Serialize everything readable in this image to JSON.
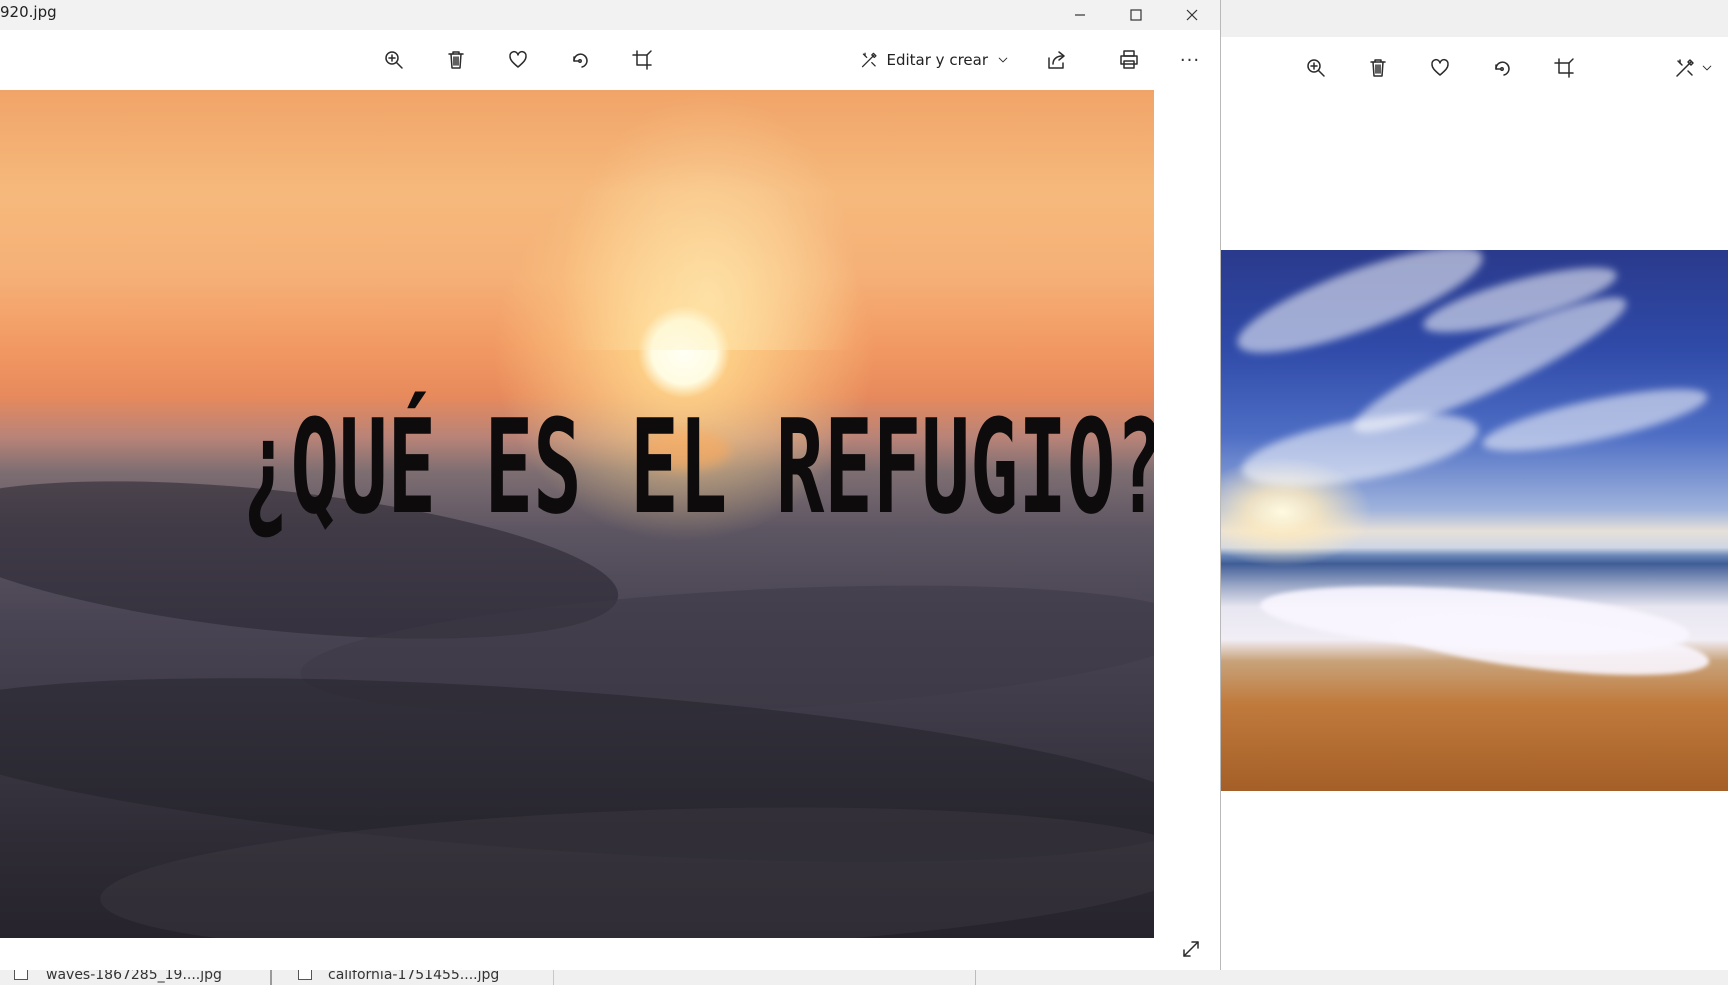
{
  "main_window": {
    "title": "920.jpg",
    "toolbar": {
      "zoom": "zoom-in-icon",
      "delete": "trash-icon",
      "favorite": "heart-icon",
      "rotate": "rotate-icon",
      "crop": "crop-icon",
      "edit_label": "Editar y crear",
      "share": "share-icon",
      "print": "print-icon",
      "more_label": "···"
    },
    "photo_text": "¿QUÉ ES EL REFUGIO?"
  },
  "secondary_window": {
    "toolbar": [
      "zoom-in-icon",
      "trash-icon",
      "heart-icon",
      "rotate-icon",
      "crop-icon",
      "edit-create-icon"
    ]
  },
  "taskbar": {
    "items": [
      {
        "label": "waves-1867285_19....jpg"
      },
      {
        "label": "california-1751455....jpg"
      }
    ]
  },
  "colors": {
    "accent": "#0a6fc2",
    "titlebar": "#f2f2f2",
    "headline": "#0d0b0c"
  }
}
